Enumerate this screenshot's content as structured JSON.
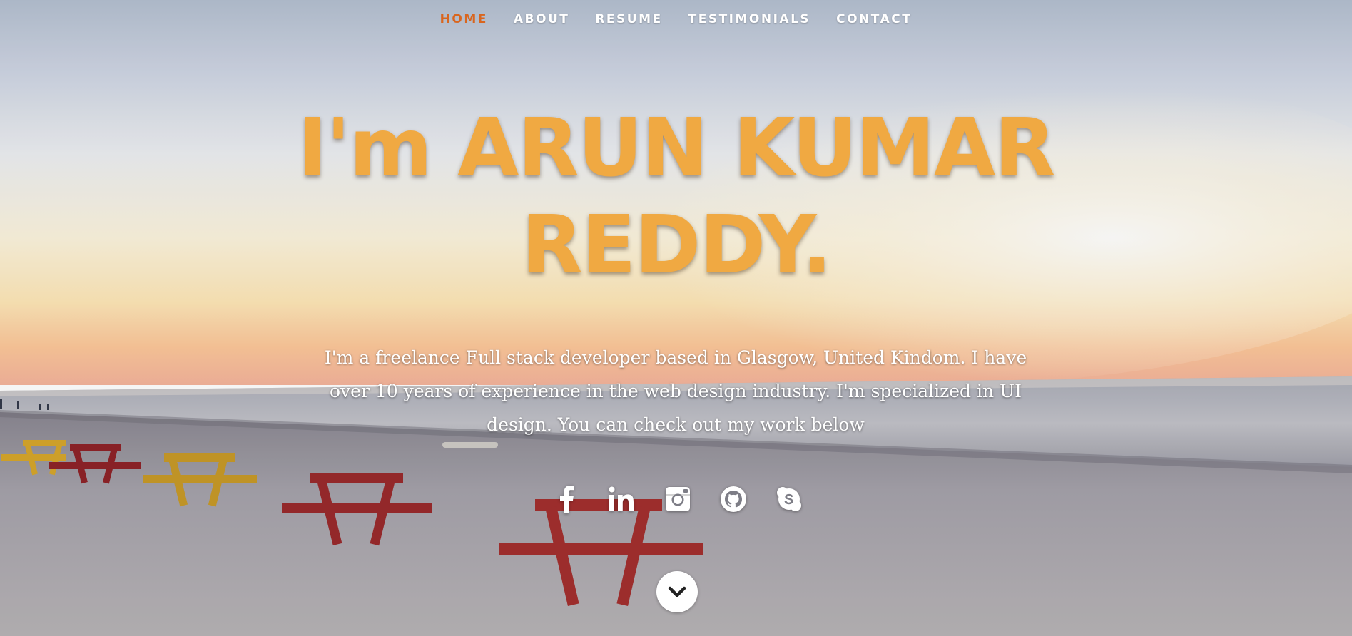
{
  "nav": {
    "items": [
      {
        "label": "HOME",
        "active": true
      },
      {
        "label": "ABOUT",
        "active": false
      },
      {
        "label": "RESUME",
        "active": false
      },
      {
        "label": "TESTIMONIALS",
        "active": false
      },
      {
        "label": "CONTACT",
        "active": false
      }
    ]
  },
  "hero": {
    "headline_line1": "I'm ARUN KUMAR",
    "headline_line2": "REDDY.",
    "intro": "I'm a freelance Full stack developer based in Glasgow, United Kindom. I have over 10 years of experience in the web design industry. I'm specialized in UI design. You can check out my work below"
  },
  "social": {
    "icons": [
      "facebook-icon",
      "linkedin-icon",
      "instagram-icon",
      "github-icon",
      "skype-icon"
    ]
  },
  "scroll_button": {
    "icon": "chevron-down-icon"
  },
  "colors": {
    "accent": "#d9661f",
    "headline": "#f0a942",
    "text": "#ffffff"
  }
}
